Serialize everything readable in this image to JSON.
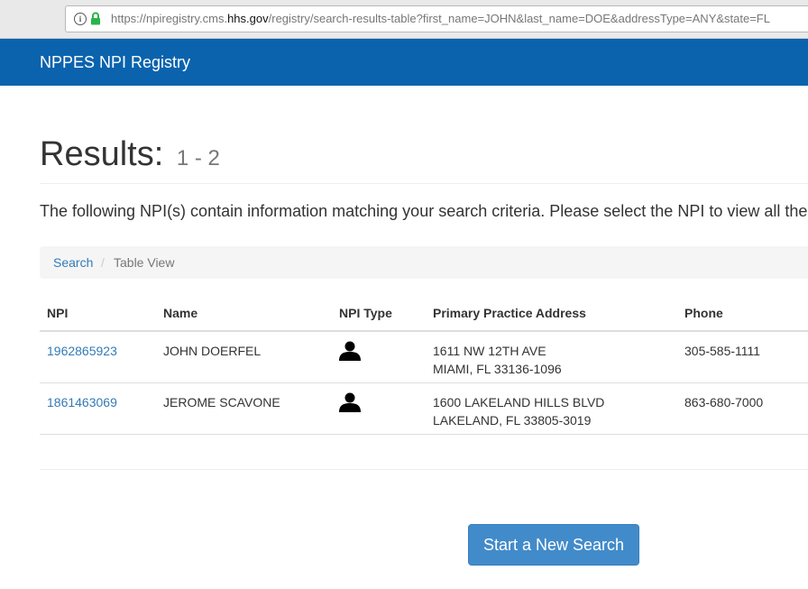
{
  "browser": {
    "url_prefix": "https://npiregistry.cms.",
    "url_domain": "hhs.gov",
    "url_suffix": "/registry/search-results-table?first_name=JOHN&last_name=DOE&addressType=ANY&state=FL"
  },
  "header": {
    "brand": "NPPES NPI Registry"
  },
  "results": {
    "title": "Results:",
    "range": "1 - 2",
    "intro": "The following NPI(s) contain information matching your search criteria. Please select the NPI to view all the"
  },
  "breadcrumb": {
    "search": "Search",
    "separator": "/",
    "current": "Table View"
  },
  "table": {
    "headers": {
      "npi": "NPI",
      "name": "Name",
      "npi_type": "NPI Type",
      "address": "Primary Practice Address",
      "phone": "Phone"
    },
    "rows": [
      {
        "npi": "1962865923",
        "name": "JOHN DOERFEL",
        "type_icon": "person-icon",
        "address_line1": "1611 NW 12TH AVE",
        "address_line2": "MIAMI, FL 33136-1096",
        "phone": "305-585-1111"
      },
      {
        "npi": "1861463069",
        "name": "JEROME SCAVONE",
        "type_icon": "person-icon",
        "address_line1": "1600 LAKELAND HILLS BLVD",
        "address_line2": "LAKELAND, FL 33805-3019",
        "phone": "863-680-7000"
      }
    ]
  },
  "actions": {
    "new_search": "Start a New Search"
  },
  "colors": {
    "navbar": "#0b63ae",
    "link": "#337ab7",
    "button": "#428bca"
  }
}
